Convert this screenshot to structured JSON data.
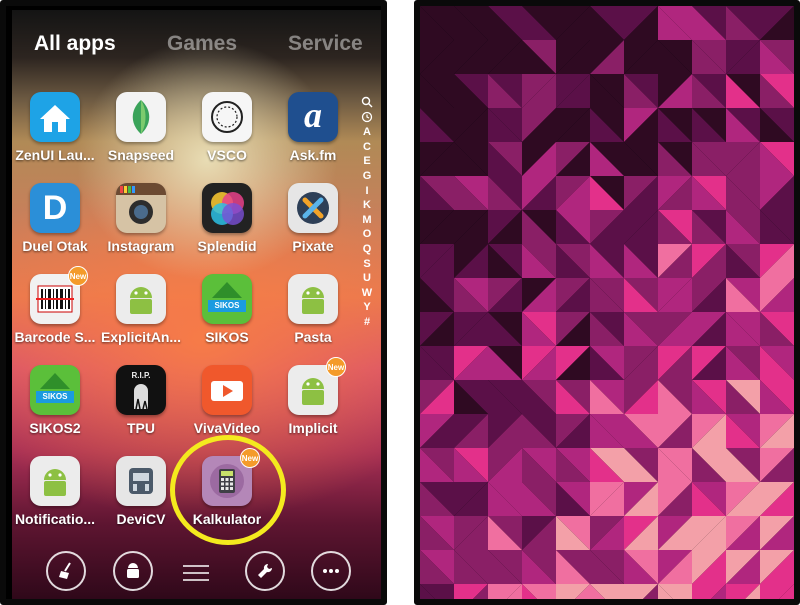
{
  "tabs": [
    {
      "label": "All apps",
      "active": true
    },
    {
      "label": "Games",
      "active": false
    },
    {
      "label": "Service",
      "active": false
    }
  ],
  "apps": [
    {
      "label": "ZenUI Lau...",
      "icon": "zenui-home-icon"
    },
    {
      "label": "Snapseed",
      "icon": "snapseed-leaf-icon"
    },
    {
      "label": "VSCO",
      "icon": "vsco-ring-icon"
    },
    {
      "label": "Ask.fm",
      "icon": "askfm-a-icon"
    },
    {
      "label": "Duel Otak",
      "icon": "duel-otak-d-icon"
    },
    {
      "label": "Instagram",
      "icon": "instagram-camera-icon"
    },
    {
      "label": "Splendid",
      "icon": "splendid-circles-icon"
    },
    {
      "label": "Pixate",
      "icon": "pixate-x-icon"
    },
    {
      "label": "Barcode S...",
      "icon": "barcode-icon",
      "badge": "New"
    },
    {
      "label": "ExplicitAn...",
      "icon": "android-robot-icon"
    },
    {
      "label": "SIKOS",
      "icon": "sikos-house-icon"
    },
    {
      "label": "Pasta",
      "icon": "android-robot-icon"
    },
    {
      "label": "SIKOS2",
      "icon": "sikos-house-icon"
    },
    {
      "label": "TPU",
      "icon": "tpu-rip-icon"
    },
    {
      "label": "VivaVideo",
      "icon": "vivavideo-play-icon"
    },
    {
      "label": "Implicit",
      "icon": "android-robot-icon",
      "badge": "New"
    },
    {
      "label": "Notificatio...",
      "icon": "android-robot-icon"
    },
    {
      "label": "DeviCV",
      "icon": "devicv-robot-icon"
    },
    {
      "label": "Kalkulator",
      "icon": "calculator-icon",
      "badge": "New"
    }
  ],
  "icon_texts": {
    "askfm": "a",
    "duel": "D",
    "sikos": "SIKOS",
    "sikos2": "SIKOS",
    "rip": "R.I.P."
  },
  "alphabet": [
    "search",
    "recent",
    "A",
    "C",
    "E",
    "G",
    "I",
    "K",
    "M",
    "O",
    "Q",
    "S",
    "U",
    "W",
    "Y",
    "#"
  ],
  "alphabet_display": [
    "",
    "",
    "A",
    "C",
    "E",
    "G",
    "I",
    "K",
    "M",
    "O",
    "Q",
    "S",
    "U",
    "W",
    "Y",
    "#"
  ],
  "dock": [
    "clean-broom-icon",
    "store-bag-icon",
    "menu-lines-icon",
    "wrench-icon",
    "more-dots-icon"
  ],
  "colors": {
    "highlight": "#f4ea1e",
    "badge": "#f49b2a",
    "wallpaper": [
      "#5b1048",
      "#8a1f66",
      "#b0267e",
      "#e3308a",
      "#f06fa0",
      "#f3a0a8",
      "#2f0a22"
    ]
  }
}
